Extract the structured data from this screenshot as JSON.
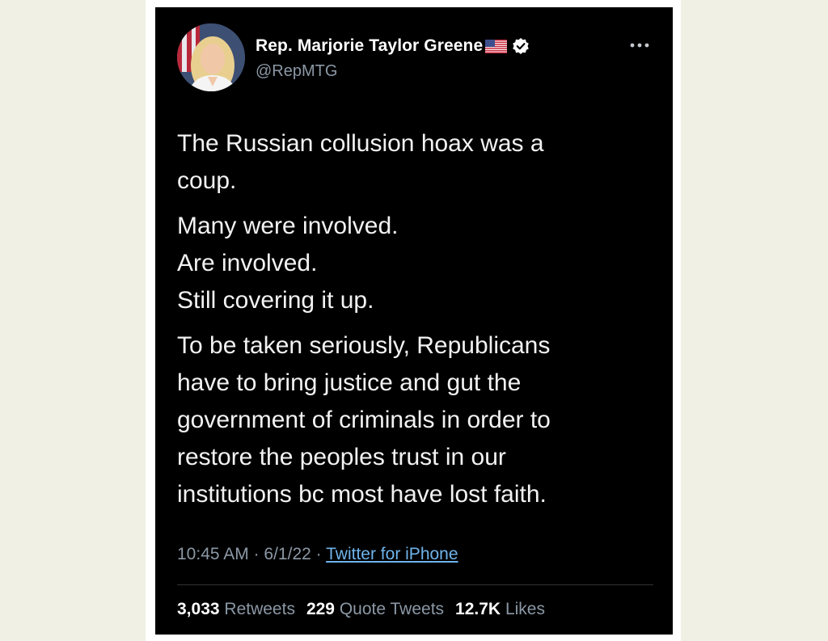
{
  "tweet": {
    "author": {
      "display_name": "Rep. Marjorie Taylor Greene",
      "handle": "@RepMTG",
      "flag_icon": "us-flag-icon",
      "verified_icon": "verified-badge-icon"
    },
    "more_icon": "more-horizontal-icon",
    "text": {
      "paragraphs": [
        [
          "The Russian collusion hoax was a",
          "coup."
        ],
        [
          "Many were involved.",
          "Are involved.",
          "Still covering it up."
        ],
        [
          "To be taken seriously, Republicans",
          "have to bring justice and gut the",
          "government of criminals in order to",
          "restore the peoples trust in our",
          "institutions bc most have lost faith."
        ]
      ]
    },
    "meta": {
      "time": "10:45 AM",
      "date": "6/1/22",
      "separator": "·",
      "source": "Twitter for iPhone"
    },
    "stats": {
      "retweets_count": "3,033",
      "retweets_label": "Retweets",
      "quotes_count": "229",
      "quotes_label": "Quote Tweets",
      "likes_count": "12.7K",
      "likes_label": "Likes"
    }
  },
  "colors": {
    "background": "#f1f0e4",
    "card": "#000000",
    "secondary_text": "#8b98a5",
    "link": "#6fb4ec",
    "verified": "#ffffff"
  }
}
